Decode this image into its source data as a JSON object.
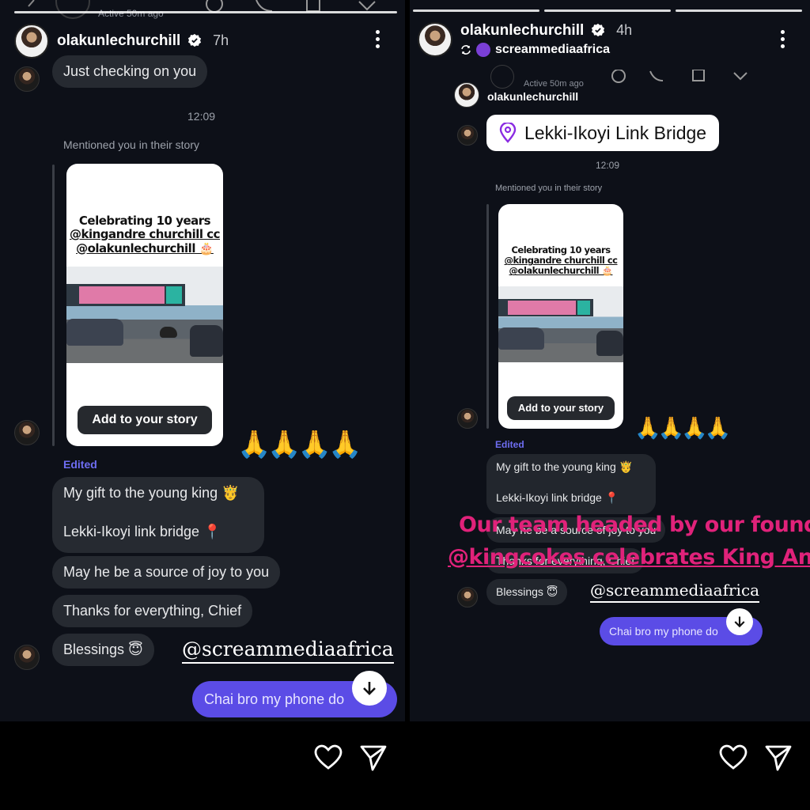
{
  "colors": {
    "background": "#0d1018",
    "bubble": "#262a31",
    "sent": "#5b4ce6",
    "edited": "#6e6df2",
    "overlay": "#e0227a",
    "verified": "#ffffff"
  },
  "left": {
    "username": "olakunlechurchill",
    "time": "7h",
    "ghost_active": "Active 50m ago",
    "msg_checking": "Just checking on you",
    "timestamp": "12:09",
    "mentioned": "Mentioned you in their story",
    "story_caption_line1": "Celebrating 10 years",
    "story_caption_line2": "@kingandre churchill cc",
    "story_caption_line3": "@olakunlechurchill 🎂",
    "add_story": "Add to your story",
    "hands": "🙏🙏🙏🙏",
    "edited": "Edited",
    "msg_gift": "My gift to the young king 🤴",
    "msg_bridge": "Lekki-Ikoyi link bridge 📍",
    "msg_joy": "May he be a source of joy to you",
    "msg_thanks": "Thanks for everything, Chief",
    "msg_blessings": "Blessings 😇",
    "mention": "@screammediaafrica",
    "sent_msg": "Chai bro my phone do"
  },
  "right": {
    "username": "olakunlechurchill",
    "time": "4h",
    "repost_account": "screammediaafrica",
    "ghost_active": "Active 50m ago",
    "nested_username": "olakunlechurchill",
    "location": "Lekki-Ikoyi Link Bridge",
    "timestamp": "12:09",
    "mentioned": "Mentioned you in their story",
    "story_caption_line1": "Celebrating 10 years",
    "story_caption_line2": "@kingandre churchill cc",
    "story_caption_line3": "@olakunlechurchill 🎂",
    "add_story": "Add to your story",
    "hands": "🙏🙏🙏🙏",
    "edited": "Edited",
    "msg_gift": "My gift to the young king 🤴",
    "msg_bridge": "Lekki-Ikoyi link bridge 📍",
    "msg_joy": "May he be a source of joy to you",
    "msg_thanks": "Thanks for everything, Chief",
    "msg_blessings": "Blessings 😇",
    "overlay_line1": "Our team headed by our founder",
    "overlay_line2": "@kingcokes celebrates King Andre",
    "mention": "@screammediaafrica",
    "sent_msg": "Chai bro my phone do"
  },
  "icons": {
    "like": "heart-icon",
    "share": "send-icon",
    "more": "kebab-menu-icon",
    "verified": "verified-badge-icon",
    "scroll": "arrow-down-icon",
    "location": "location-pin-icon",
    "repost": "repost-icon"
  }
}
